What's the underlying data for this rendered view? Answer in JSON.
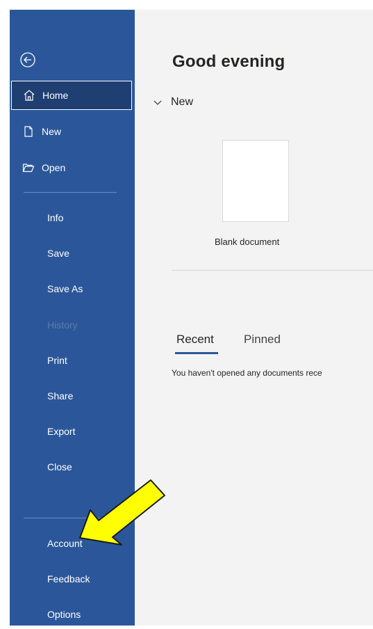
{
  "sidebar": {
    "items": [
      {
        "label": "Home",
        "icon": "home-icon"
      },
      {
        "label": "New",
        "icon": "new-document-icon"
      },
      {
        "label": "Open",
        "icon": "open-folder-icon"
      },
      {
        "label": "Info"
      },
      {
        "label": "Save"
      },
      {
        "label": "Save As"
      },
      {
        "label": "History"
      },
      {
        "label": "Print"
      },
      {
        "label": "Share"
      },
      {
        "label": "Export"
      },
      {
        "label": "Close"
      },
      {
        "label": "Account"
      },
      {
        "label": "Feedback"
      },
      {
        "label": "Options"
      }
    ]
  },
  "main": {
    "greeting": "Good evening",
    "new_section": "New",
    "blank_document_label": "Blank document",
    "tabs": [
      {
        "label": "Recent"
      },
      {
        "label": "Pinned"
      }
    ],
    "empty_message": "You haven't opened any documents rece"
  },
  "colors": {
    "sidebar_bg": "#2b579a",
    "active_item_bg": "#1f3f73",
    "main_bg": "#f3f3f3",
    "annotation_arrow": "#ffff00"
  }
}
